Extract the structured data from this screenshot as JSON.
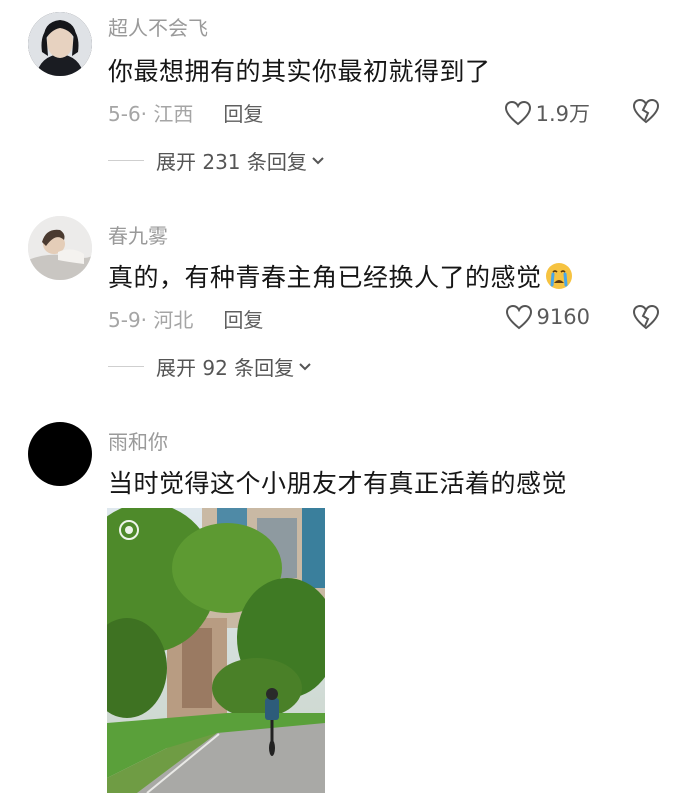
{
  "comments": [
    {
      "username": "超人不会飞",
      "text": "你最想拥有的其实你最初就得到了",
      "date_location": "5-6· 江西",
      "reply_label": "回复",
      "likes": "1.9万",
      "expand_label": "展开 231 条回复"
    },
    {
      "username": "春九雾",
      "text": "真的，有种青春主角已经换人了的感觉",
      "emoji": "crying-face-icon",
      "date_location": "5-9· 河北",
      "reply_label": "回复",
      "likes": "9160",
      "expand_label": "展开 92 条回复"
    },
    {
      "username": "雨和你",
      "text": "当时觉得这个小朋友才有真正活着的感觉",
      "has_image": true
    }
  ],
  "colors": {
    "text_primary": "#161616",
    "text_secondary": "#9a9a9a",
    "background": "#ffffff"
  }
}
